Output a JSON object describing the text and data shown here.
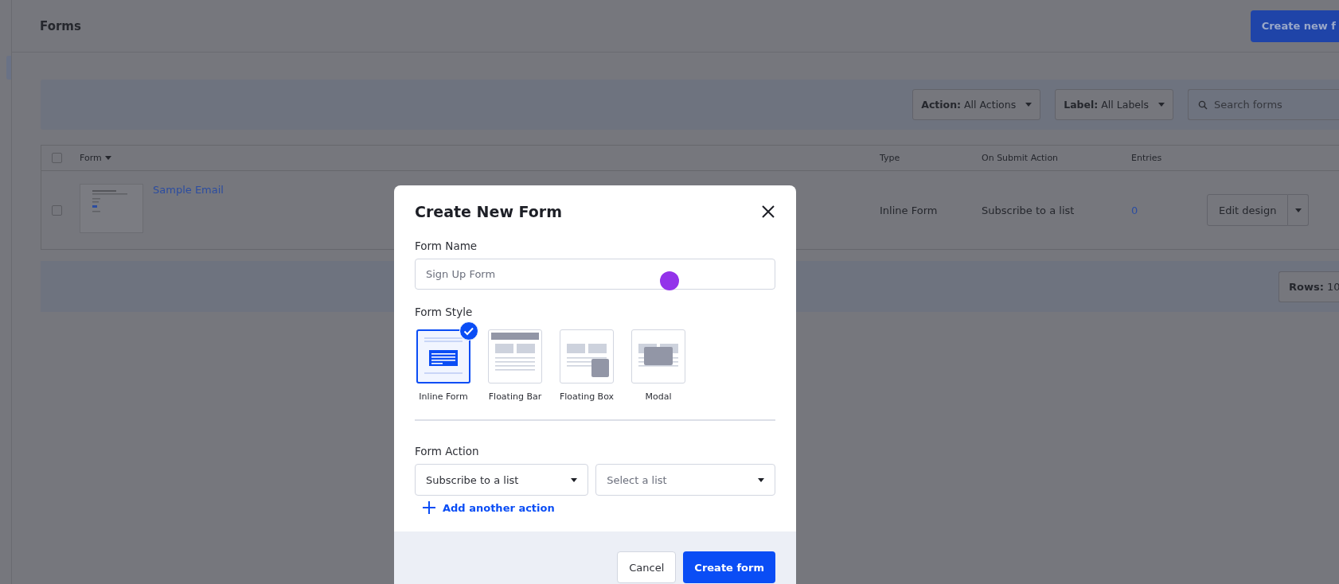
{
  "header": {
    "title": "Forms",
    "create_button": "Create new f"
  },
  "filters": {
    "action": {
      "label": "Action:",
      "value": "All Actions"
    },
    "label": {
      "label": "Label:",
      "value": "All Labels"
    },
    "search": {
      "placeholder": "Search forms"
    }
  },
  "table": {
    "select_all": false,
    "columns": [
      "Form",
      "Type",
      "On Submit Action",
      "Entries"
    ],
    "rows": [
      {
        "checked": false,
        "name": "Sample Email",
        "type": "Inline Form",
        "action": "Subscribe to a list",
        "entries": "0",
        "button": "Edit design"
      }
    ]
  },
  "pagination": {
    "rows_label": "Rows:",
    "rows_value": "10"
  },
  "dialog": {
    "title": "Create New Form",
    "name_label": "Form Name",
    "name_placeholder": "Sign Up Form",
    "style_label": "Form Style",
    "styles": [
      {
        "kind": "inline",
        "label": "Inline Form",
        "selected": true
      },
      {
        "kind": "bar",
        "label": "Floating Bar",
        "selected": false
      },
      {
        "kind": "box",
        "label": "Floating Box",
        "selected": false
      },
      {
        "kind": "modal",
        "label": "Modal",
        "selected": false
      }
    ],
    "action_label": "Form Action",
    "action_value": "Subscribe to a list",
    "list_placeholder": "Select a list",
    "add_action": "Add another action",
    "cancel": "Cancel",
    "create": "Create form"
  }
}
